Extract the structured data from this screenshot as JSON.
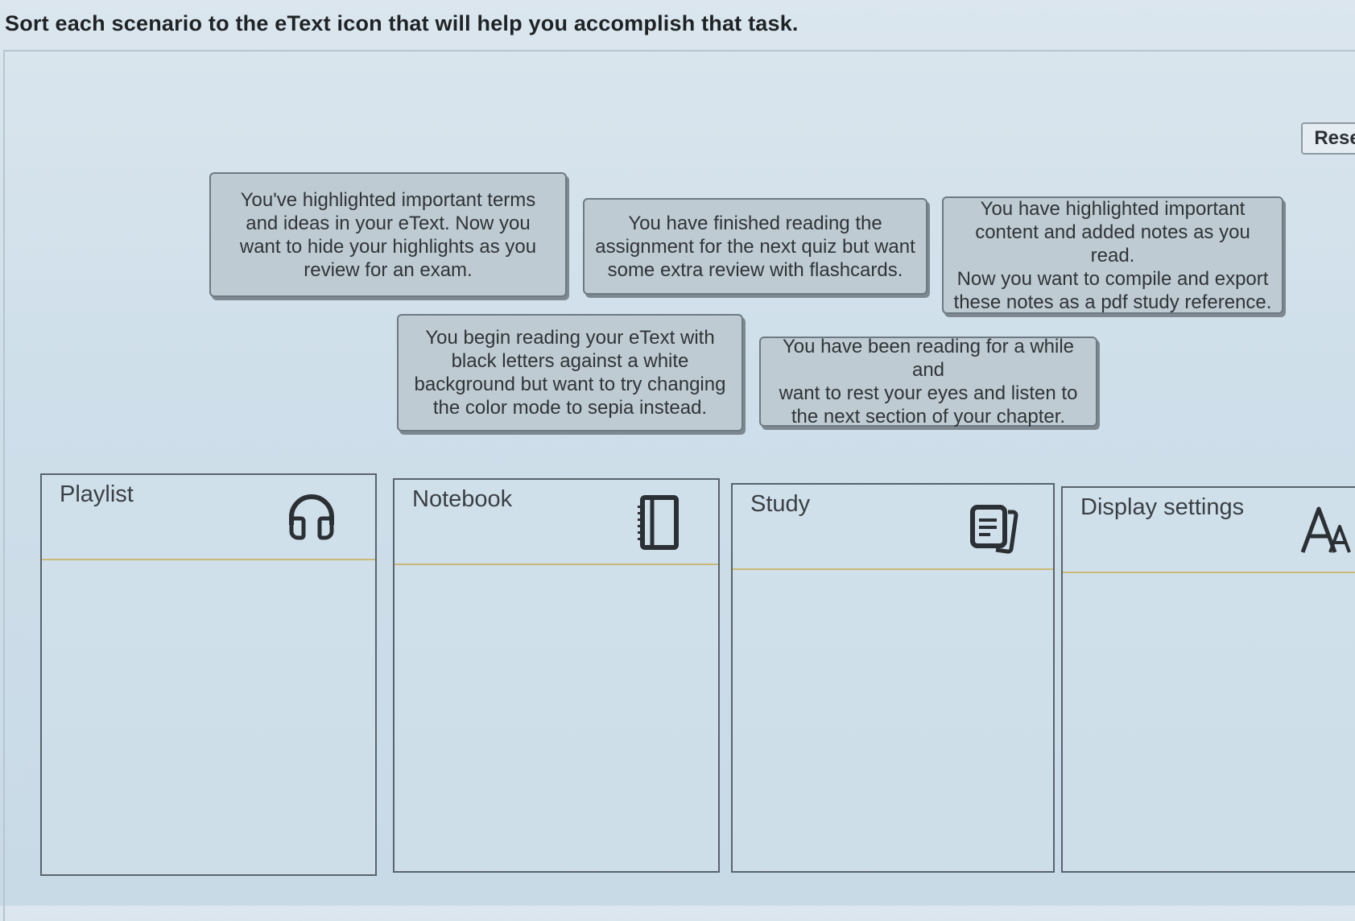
{
  "instruction": "Sort each scenario to the eText icon that will help you accomplish that task.",
  "reset_label": "Rese",
  "cards": [
    {
      "lines": [
        "You've highlighted important terms",
        "and ideas in your eText. Now you",
        "want to hide your highlights as you",
        "review for an exam."
      ]
    },
    {
      "lines": [
        "You have finished reading the",
        "assignment for the next quiz but want",
        "some extra review with flashcards."
      ]
    },
    {
      "lines": [
        "You have highlighted important",
        "content and added notes as you read.",
        "Now you want to compile and export",
        "these notes as a pdf study reference."
      ]
    },
    {
      "lines": [
        "You begin reading your eText with",
        "black letters against a white",
        "background but want to try changing",
        "the color mode to sepia instead."
      ]
    },
    {
      "lines": [
        "You have been reading for a while and",
        "want to rest your eyes and listen to",
        "the next section of your chapter."
      ]
    }
  ],
  "bins": [
    {
      "title": "Playlist",
      "icon": "headphones-icon"
    },
    {
      "title": "Notebook",
      "icon": "notebook-icon"
    },
    {
      "title": "Study",
      "icon": "study-cards-icon"
    },
    {
      "title": "Display settings",
      "icon": "font-size-icon"
    }
  ]
}
